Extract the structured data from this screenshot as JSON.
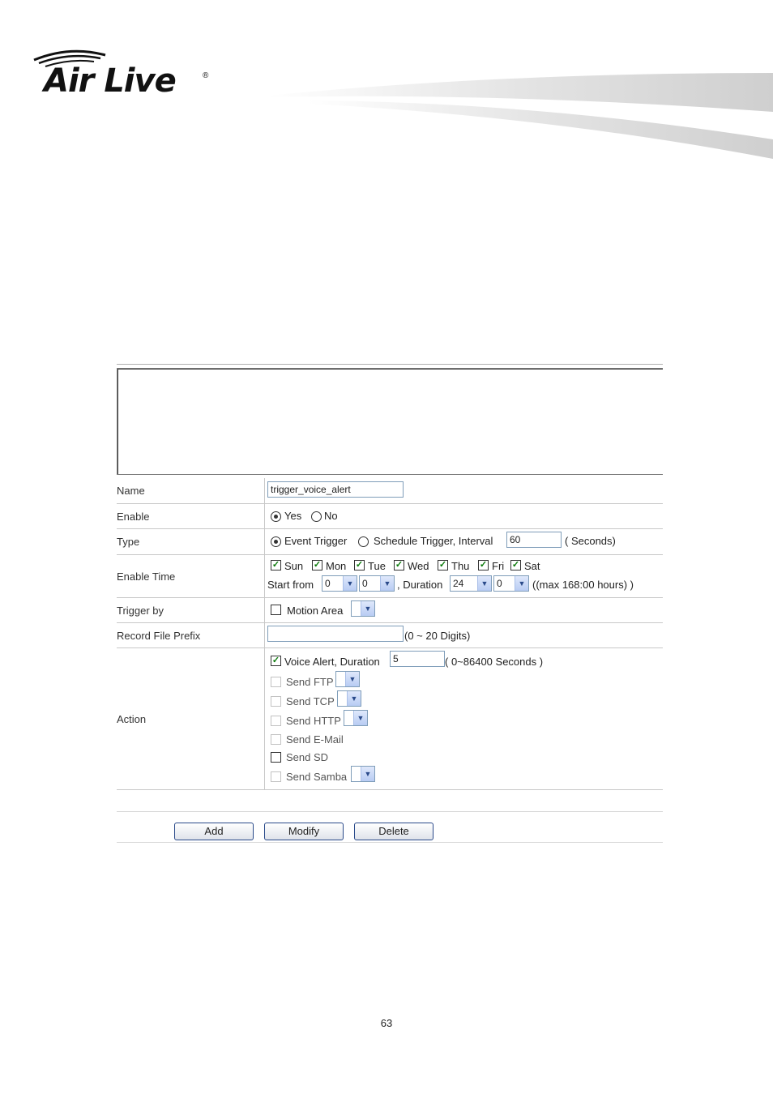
{
  "brand": {
    "logo_text": "Air Live",
    "registered": "®"
  },
  "form": {
    "name_label": "Name",
    "name_value": "trigger_voice_alert",
    "enable_label": "Enable",
    "enable_yes": "Yes",
    "enable_no": "No",
    "enable_selected": "Yes",
    "type_label": "Type",
    "type_event": "Event Trigger",
    "type_schedule": "Schedule Trigger, Interval",
    "type_selected": "Event Trigger",
    "interval_value": "60",
    "interval_unit": "( Seconds)",
    "enable_time_label": "Enable Time",
    "days": [
      {
        "label": "Sun",
        "checked": true
      },
      {
        "label": "Mon",
        "checked": true
      },
      {
        "label": "Tue",
        "checked": true
      },
      {
        "label": "Wed",
        "checked": true
      },
      {
        "label": "Thu",
        "checked": true
      },
      {
        "label": "Fri",
        "checked": true
      },
      {
        "label": "Sat",
        "checked": true
      }
    ],
    "start_from_label": "Start from",
    "start_hour": "0",
    "start_min": "0",
    "duration_label": ", Duration",
    "duration_hour": "24",
    "duration_min": "0",
    "duration_note": "((max 168:00 hours) )",
    "trigger_by_label": "Trigger by",
    "motion_area": "Motion Area",
    "record_prefix_label": "Record File Prefix",
    "record_prefix_value": "",
    "record_prefix_note": "(0 ~ 20 Digits)",
    "action_label": "Action",
    "voice_alert": "Voice Alert, Duration",
    "voice_duration": "5",
    "voice_note": "( 0~86400 Seconds )",
    "send_ftp": "Send FTP",
    "send_tcp": "Send TCP",
    "send_http": "Send HTTP",
    "send_email": "Send E-Mail",
    "send_sd": "Send SD",
    "send_samba": "Send Samba"
  },
  "buttons": {
    "add": "Add",
    "modify": "Modify",
    "delete": "Delete"
  },
  "page_number": "63"
}
